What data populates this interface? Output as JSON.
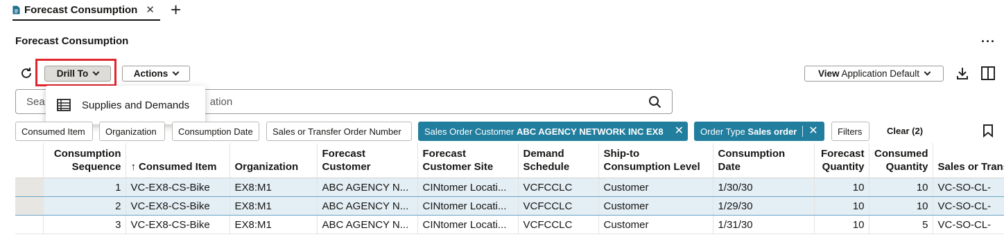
{
  "tab": {
    "title": "Forecast Consumption",
    "close": "✕",
    "new_tab": "+"
  },
  "page": {
    "title": "Forecast Consumption",
    "more": "···"
  },
  "toolbar": {
    "drill_to": "Drill To",
    "actions": "Actions",
    "view_prefix": "View",
    "view_value": "Application Default"
  },
  "search": {
    "left_text": "Sea",
    "right_text": "ation"
  },
  "dropdown": {
    "items": [
      {
        "label": "Supplies and Demands",
        "icon": "table-icon"
      }
    ]
  },
  "filters": {
    "chips": [
      "Consumed Item",
      "Organization",
      "Consumption Date",
      "Sales or Transfer Order Number",
      "Filters"
    ],
    "active": [
      {
        "label": "Sales Order Customer",
        "value": "ABC AGENCY NETWORK INC EX8"
      },
      {
        "label": "Order Type",
        "value": "Sales order"
      }
    ],
    "clear": "Clear (2)"
  },
  "table": {
    "headers": {
      "sequence": "Consumption Sequence",
      "item": "Consumed Item",
      "sort_arrow": "↑",
      "org": "Organization",
      "customer": "Forecast Customer",
      "site": "Forecast Customer Site",
      "schedule": "Demand Schedule",
      "level": "Ship-to Consumption Level",
      "date": "Consumption Date",
      "fqty": "Forecast Quantity",
      "cqty": "Consumed Quantity",
      "order": "Sales or Transfer Order Number"
    },
    "rows": [
      {
        "sequence": "1",
        "item": "VC-EX8-CS-Bike",
        "org": "EX8:M1",
        "customer": "ABC AGENCY N...",
        "site": "CINtomer Locati...",
        "schedule": "VCFCCLC",
        "level": "Customer",
        "date": "1/30/30",
        "fqty": "10",
        "cqty": "10",
        "order": "VC-SO-CL-"
      },
      {
        "sequence": "2",
        "item": "VC-EX8-CS-Bike",
        "org": "EX8:M1",
        "customer": "ABC AGENCY N...",
        "site": "CINtomer Locati...",
        "schedule": "VCFCCLC",
        "level": "Customer",
        "date": "1/29/30",
        "fqty": "10",
        "cqty": "10",
        "order": "VC-SO-CL-"
      },
      {
        "sequence": "3",
        "item": "VC-EX8-CS-Bike",
        "org": "EX8:M1",
        "customer": "ABC AGENCY N...",
        "site": "CINtomer Locati...",
        "schedule": "VCFCCLC",
        "level": "Customer",
        "date": "1/31/30",
        "fqty": "10",
        "cqty": "5",
        "order": "VC-SO-CL-"
      }
    ]
  },
  "colors": {
    "accent": "#227e9e",
    "highlight": "#e0262d",
    "selected_row": "#e3eef5"
  }
}
